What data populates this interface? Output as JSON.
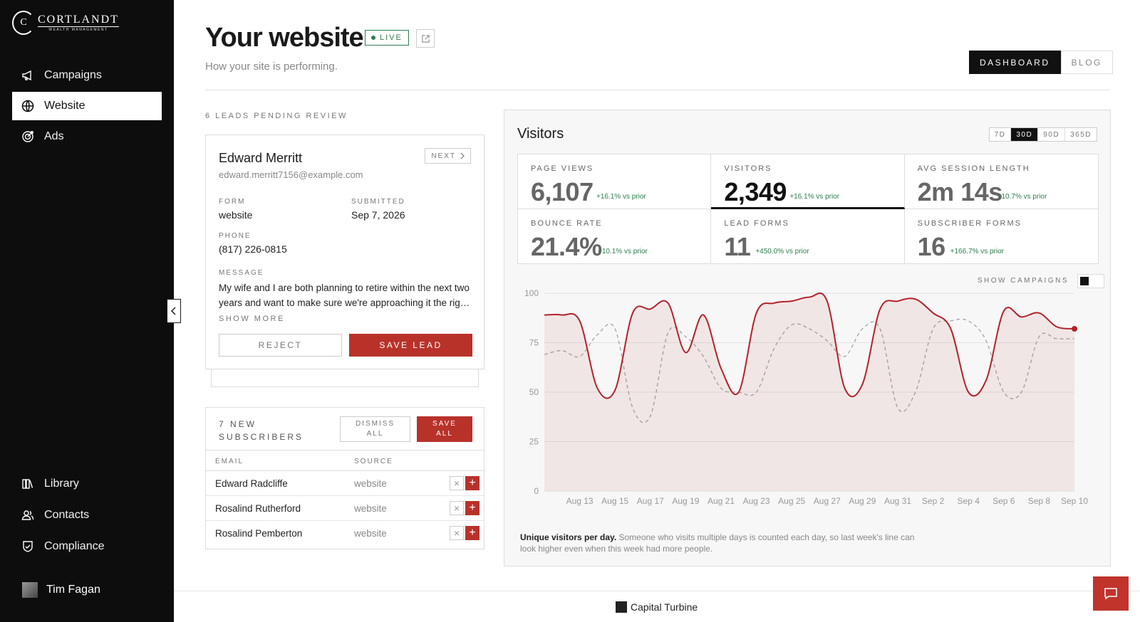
{
  "brand": {
    "logo_initial": "C",
    "name": "Cortlandt",
    "tagline": "Wealth Management"
  },
  "sidebar": {
    "top_items": [
      {
        "label": "Campaigns",
        "icon": "megaphone-icon"
      },
      {
        "label": "Website",
        "icon": "globe-icon",
        "active": true
      },
      {
        "label": "Ads",
        "icon": "target-icon"
      }
    ],
    "bottom_items": [
      {
        "label": "Library",
        "icon": "library-icon"
      },
      {
        "label": "Contacts",
        "icon": "contacts-icon"
      },
      {
        "label": "Compliance",
        "icon": "shield-check-icon"
      }
    ],
    "user": {
      "name": "Tim Fagan"
    }
  },
  "header": {
    "title": "Your website",
    "live_label": "LIVE",
    "subtitle": "How your site is performing.",
    "tabs": [
      {
        "label": "DASHBOARD",
        "active": true
      },
      {
        "label": "BLOG",
        "active": false
      }
    ]
  },
  "leads": {
    "section_label": "6 LEADS PENDING REVIEW",
    "next_label": "NEXT",
    "name": "Edward Merritt",
    "email": "edward.merritt7156@example.com",
    "form_label": "FORM",
    "form_value": "website",
    "submitted_label": "SUBMITTED",
    "submitted_value": "Sep 7, 2026",
    "phone_label": "PHONE",
    "phone_value": "(817) 226-0815",
    "message_label": "MESSAGE",
    "message": "My wife and I are both planning to retire within the next two years and want to make sure we're approaching it the rig…",
    "show_more": "SHOW MORE",
    "reject_label": "REJECT",
    "save_label": "SAVE LEAD"
  },
  "subscribers": {
    "title": "7 NEW SUBSCRIBERS",
    "dismiss_label": "DISMISS ALL",
    "save_all_label": "SAVE ALL",
    "col_email": "EMAIL",
    "col_source": "SOURCE",
    "rows": [
      {
        "name": "Edward Radcliffe",
        "source": "website"
      },
      {
        "name": "Rosalind Rutherford",
        "source": "website"
      },
      {
        "name": "Rosalind Pemberton",
        "source": "website"
      }
    ]
  },
  "visitors": {
    "title": "Visitors",
    "ranges": [
      {
        "label": "7D",
        "active": false
      },
      {
        "label": "30D",
        "active": true
      },
      {
        "label": "90D",
        "active": false
      },
      {
        "label": "365D",
        "active": false
      }
    ],
    "metrics": [
      {
        "label": "PAGE VIEWS",
        "value": "6,107",
        "delta": "+16.1% vs prior",
        "selected": false
      },
      {
        "label": "VISITORS",
        "value": "2,349",
        "delta": "+16.1% vs prior",
        "selected": true
      },
      {
        "label": "AVG SESSION LENGTH",
        "value": "2m 14s",
        "delta": "+10.7% vs prior",
        "selected": false
      },
      {
        "label": "BOUNCE RATE",
        "value": "21.4%",
        "delta": "−10.1% vs prior",
        "selected": false
      },
      {
        "label": "LEAD FORMS",
        "value": "11",
        "delta": "+450.0% vs prior",
        "selected": false
      },
      {
        "label": "SUBSCRIBER FORMS",
        "value": "16",
        "delta": "+166.7% vs prior",
        "selected": false
      }
    ],
    "show_campaigns_label": "SHOW CAMPAIGNS",
    "caption_bold": "Unique visitors per day.",
    "caption_text": " Someone who visits multiple days is counted each day, so last week's line can look higher even when this week had more people."
  },
  "chart_data": {
    "type": "line",
    "x": [
      "Aug 11",
      "Aug 12",
      "Aug 13",
      "Aug 14",
      "Aug 15",
      "Aug 16",
      "Aug 17",
      "Aug 18",
      "Aug 19",
      "Aug 20",
      "Aug 21",
      "Aug 22",
      "Aug 23",
      "Aug 24",
      "Aug 25",
      "Aug 26",
      "Aug 27",
      "Aug 28",
      "Aug 29",
      "Aug 30",
      "Aug 31",
      "Sep 1",
      "Sep 2",
      "Sep 3",
      "Sep 4",
      "Sep 5",
      "Sep 6",
      "Sep 7",
      "Sep 8",
      "Sep 9",
      "Sep 10"
    ],
    "tick_labels": [
      "Aug 13",
      "Aug 15",
      "Aug 17",
      "Aug 19",
      "Aug 21",
      "Aug 23",
      "Aug 25",
      "Aug 27",
      "Aug 29",
      "Aug 31",
      "Sep 2",
      "Sep 4",
      "Sep 6",
      "Sep 8",
      "Sep 10"
    ],
    "ylim": [
      0,
      100
    ],
    "yticks": [
      0,
      25,
      50,
      75,
      100
    ],
    "series": [
      {
        "values": [
          89,
          89,
          86,
          52,
          51,
          90,
          92,
          95,
          70,
          89,
          62,
          50,
          90,
          95,
          96,
          98,
          96,
          52,
          54,
          92,
          96,
          97,
          90,
          82,
          50,
          56,
          91,
          88,
          90,
          83,
          82
        ],
        "color": "#b3222b",
        "style": "solid",
        "fill": true
      },
      {
        "values": [
          69,
          71,
          68,
          79,
          82,
          42,
          38,
          80,
          78,
          68,
          52,
          50,
          50,
          72,
          84,
          82,
          76,
          68,
          82,
          82,
          42,
          50,
          82,
          86,
          86,
          76,
          50,
          50,
          78,
          77,
          77
        ],
        "color": "#aaaaaa",
        "style": "dashed"
      }
    ],
    "grid": true,
    "legend": "none"
  },
  "footer": {
    "brand": "Capital Turbine"
  }
}
